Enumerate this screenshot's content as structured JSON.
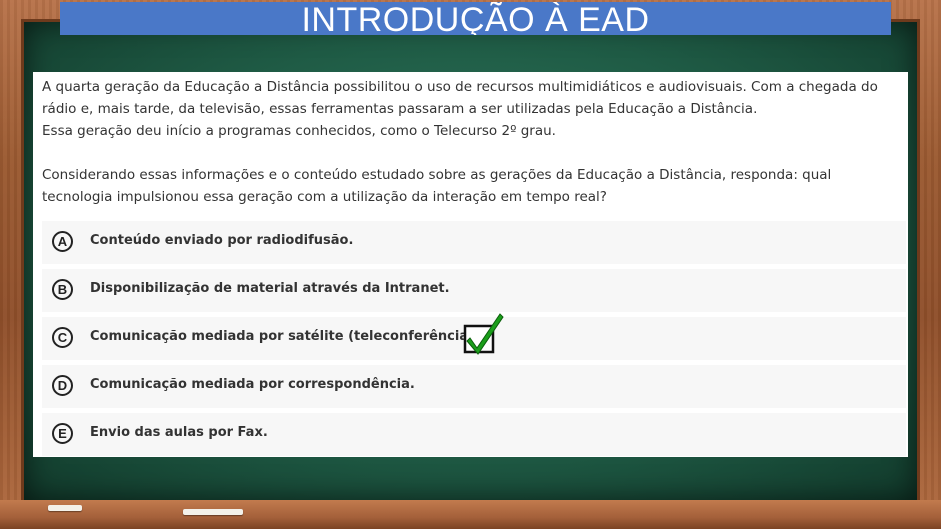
{
  "title": "INTRODUÇÃO À EAD",
  "question": {
    "line1": "A quarta geração da Educação a Distância possibilitou o uso de recursos multimidiáticos e audiovisuais. Com a chegada do rádio e, mais tarde, da televisão, essas ferramentas passaram a ser utilizadas pela Educação a Distância.",
    "line2": "Essa geração deu início a programas conhecidos, como o Telecurso 2º grau.",
    "line3": "Considerando essas informações e o conteúdo estudado sobre as gerações da Educação a Distância, responda: qual tecnologia impulsionou essa geração com a utilização da interação em tempo real?"
  },
  "options": [
    {
      "letter": "A",
      "text": "Conteúdo enviado por radiodifusão."
    },
    {
      "letter": "B",
      "text": "Disponibilização de material através da Intranet."
    },
    {
      "letter": "C",
      "text": "Comunicação mediada por satélite (teleconferência)."
    },
    {
      "letter": "D",
      "text": "Comunicação mediada por correspondência."
    },
    {
      "letter": "E",
      "text": "Envio das aulas por Fax."
    }
  ],
  "correct_option": "C",
  "colors": {
    "banner": "#4a78c8",
    "check": "#1a9e1a",
    "board": "#1f5b45",
    "frame": "#9b5a31"
  }
}
